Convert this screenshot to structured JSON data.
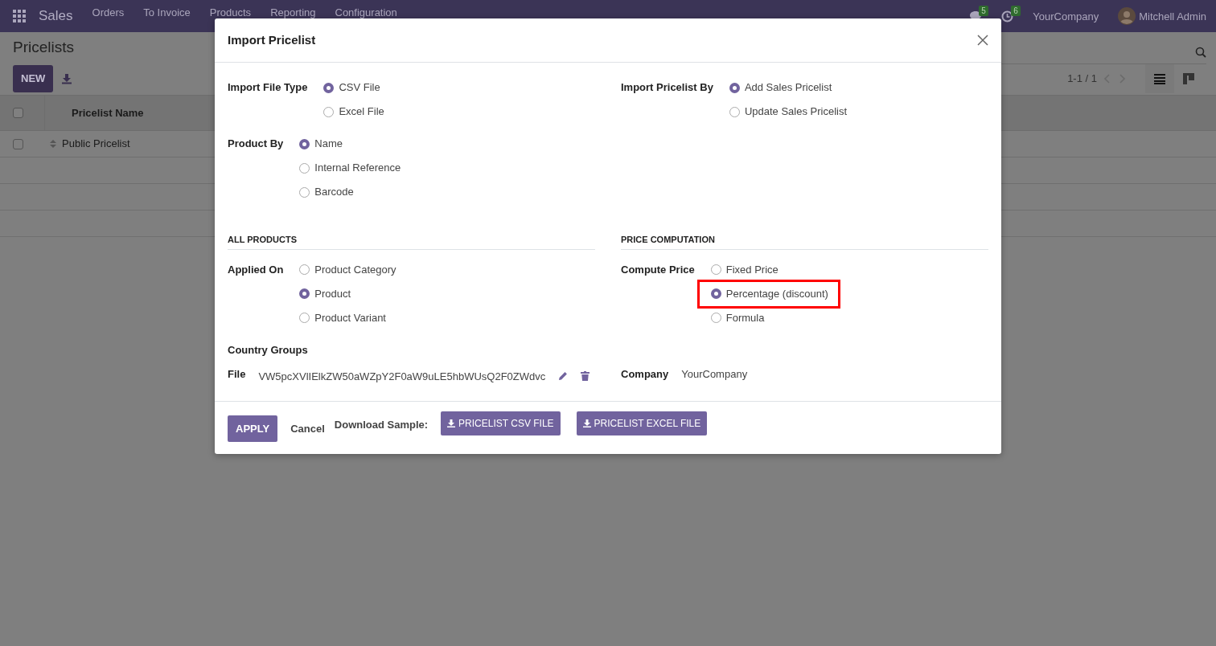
{
  "navbar": {
    "app": "Sales",
    "menu": [
      "Orders",
      "To Invoice",
      "Products",
      "Reporting",
      "Configuration"
    ],
    "messages_count": "5",
    "activities_count": "6",
    "company": "YourCompany",
    "user": "Mitchell Admin"
  },
  "page": {
    "title": "Pricelists",
    "new_button": "NEW",
    "pager": "1-1 / 1",
    "views": [
      {
        "kind": "list",
        "selected": true
      },
      {
        "kind": "kanban",
        "selected": false
      }
    ],
    "table": {
      "select_all": false,
      "columns": [
        "Pricelist Name"
      ],
      "rows": [
        {
          "name": "Public Pricelist",
          "checked": false
        }
      ]
    }
  },
  "dialog": {
    "title": "Import Pricelist",
    "rows": [
      {
        "cells": [
          [
            {
              "kind": "radio",
              "label": "Import File Type",
              "options": [
                {
                  "label": "CSV File",
                  "selected": true
                },
                {
                  "label": "Excel File",
                  "selected": false
                }
              ]
            },
            {
              "kind": "radio",
              "label": "Product By",
              "options": [
                {
                  "label": "Name",
                  "selected": true
                },
                {
                  "label": "Internal Reference",
                  "selected": false
                },
                {
                  "label": "Barcode",
                  "selected": false
                }
              ]
            }
          ],
          [
            {
              "kind": "radio",
              "label": "Import Pricelist By",
              "options": [
                {
                  "label": "Add Sales Pricelist",
                  "selected": true
                },
                {
                  "label": "Update Sales Pricelist",
                  "selected": false
                }
              ]
            }
          ]
        ]
      },
      {
        "cells": [
          [
            {
              "kind": "section",
              "label": "ALL PRODUCTS"
            }
          ],
          [
            {
              "kind": "section",
              "label": "PRICE COMPUTATION"
            }
          ]
        ]
      },
      {
        "cells": [
          [
            {
              "kind": "radio",
              "label": "Applied On",
              "options": [
                {
                  "label": "Product Category",
                  "selected": false
                },
                {
                  "label": "Product",
                  "selected": true
                },
                {
                  "label": "Product Variant",
                  "selected": false
                }
              ]
            }
          ],
          [
            {
              "kind": "radio",
              "label": "Compute Price",
              "options": [
                {
                  "label": "Fixed Price",
                  "selected": false
                },
                {
                  "label": "Percentage (discount)",
                  "selected": true,
                  "highlighted": true
                },
                {
                  "label": "Formula",
                  "selected": false
                }
              ]
            }
          ]
        ]
      },
      {
        "cells": [
          [
            {
              "kind": "field",
              "label": "Country Groups"
            }
          ]
        ]
      },
      {
        "cells": [
          [
            {
              "kind": "file",
              "label": "File",
              "value": "VW5pcXVlIElkZW50aWZpY2F0aW9uLE5hbWUsQ2F0ZWdvc"
            }
          ],
          [
            {
              "kind": "field",
              "label": "Company",
              "value": "YourCompany"
            }
          ]
        ]
      }
    ],
    "footer": {
      "apply": "APPLY",
      "cancel": "Cancel",
      "download_label": "Download Sample:",
      "downloads": [
        "PRICELIST CSV FILE",
        "PRICELIST EXCEL FILE"
      ]
    }
  }
}
